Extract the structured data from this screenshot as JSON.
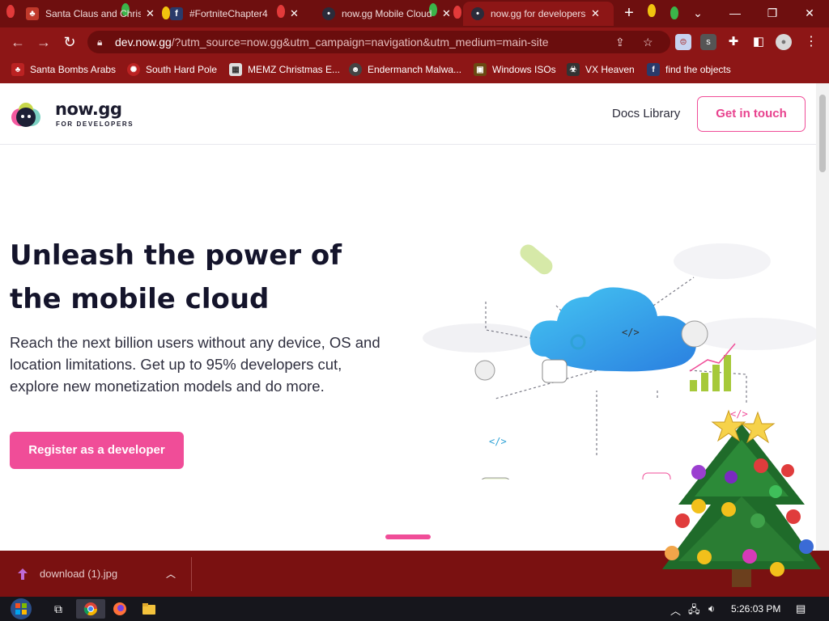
{
  "tabs": [
    {
      "title": "Santa Claus and Christ",
      "icon": "santa-icon"
    },
    {
      "title": "#FortniteChapter4",
      "icon": "fortnite-icon"
    },
    {
      "title": "now.gg Mobile Cloud",
      "icon": "nowgg-icon"
    },
    {
      "title": "now.gg for developers",
      "icon": "nowgg-icon"
    }
  ],
  "address": {
    "host": "dev.now.gg",
    "path": "/?utm_source=now.gg&utm_campaign=navigation&utm_medium=main-site"
  },
  "bookmarks": [
    {
      "label": "Santa Bombs Arabs",
      "icon": "santa-icon"
    },
    {
      "label": "South Hard Pole",
      "icon": "pole-icon"
    },
    {
      "label": "MEMZ Christmas E...",
      "icon": "memz-icon"
    },
    {
      "label": "Endermanch Malwa...",
      "icon": "endermanch-icon"
    },
    {
      "label": "Windows ISOs",
      "icon": "windows-icon"
    },
    {
      "label": "VX Heaven",
      "icon": "vx-icon"
    },
    {
      "label": "find the objects",
      "icon": "facebook-icon"
    }
  ],
  "site": {
    "logo_name": "now.gg",
    "logo_sub": "FOR DEVELOPERS",
    "nav_docs": "Docs Library",
    "nav_contact": "Get in touch",
    "hero_title": "Unleash the power of the mobile cloud",
    "hero_body": "Reach the next billion users without any device, OS and location limitations. Get up to 95% developers cut, explore new monetization models and do more.",
    "cta": "Register as a developer",
    "accent": "#f04d98"
  },
  "download": {
    "filename": "download (1).jpg"
  },
  "taskbar": {
    "clock": "5:26:03 PM"
  }
}
